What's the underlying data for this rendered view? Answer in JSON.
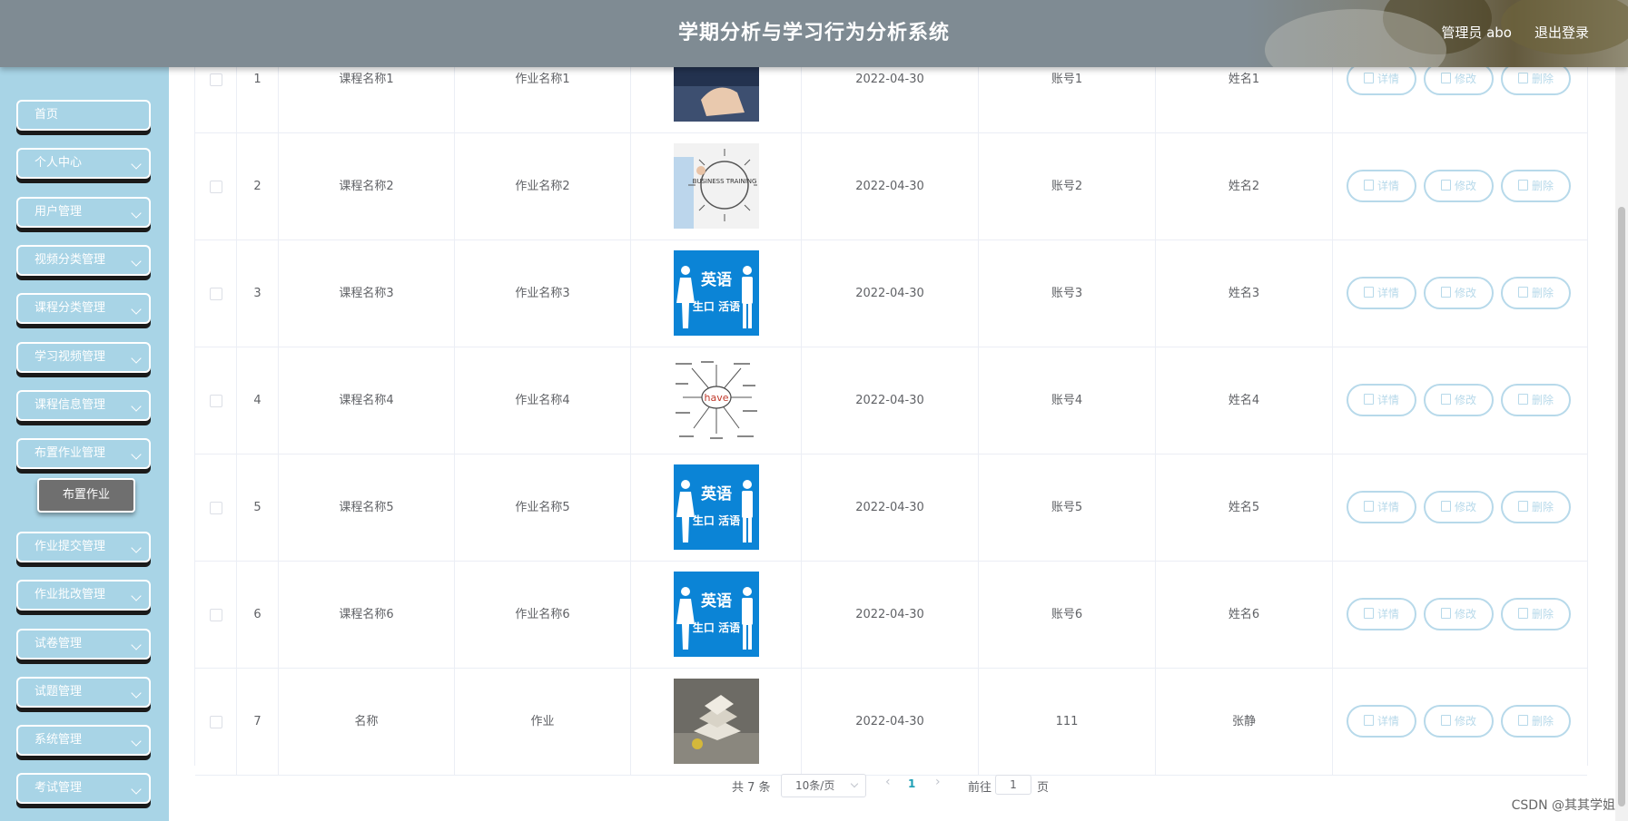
{
  "header": {
    "title": "学期分析与学习行为分析系统",
    "user": "管理员 abo",
    "logout": "退出登录"
  },
  "sidebar": {
    "items": [
      {
        "label": "首页",
        "expand": false
      },
      {
        "label": "个人中心",
        "expand": true
      },
      {
        "label": "用户管理",
        "expand": true
      },
      {
        "label": "视频分类管理",
        "expand": true
      },
      {
        "label": "课程分类管理",
        "expand": true
      },
      {
        "label": "学习视频管理",
        "expand": true
      },
      {
        "label": "课程信息管理",
        "expand": true
      },
      {
        "label": "布置作业管理",
        "expand": true
      },
      {
        "label": "作业提交管理",
        "expand": true
      },
      {
        "label": "作业批改管理",
        "expand": true
      },
      {
        "label": "试卷管理",
        "expand": true
      },
      {
        "label": "试题管理",
        "expand": true
      },
      {
        "label": "系统管理",
        "expand": true
      },
      {
        "label": "考试管理",
        "expand": true
      }
    ],
    "active_submenu": "布置作业"
  },
  "table": {
    "rows": [
      {
        "index": "1",
        "course": "课程名称1",
        "homework": "作业名称1",
        "date": "2022-04-30",
        "account": "账号1",
        "name": "姓名1",
        "image": "hand-writing"
      },
      {
        "index": "2",
        "course": "课程名称2",
        "homework": "作业名称2",
        "date": "2022-04-30",
        "account": "账号2",
        "name": "姓名2",
        "image": "business-training"
      },
      {
        "index": "3",
        "course": "课程名称3",
        "homework": "作业名称3",
        "date": "2022-04-30",
        "account": "账号3",
        "name": "姓名3",
        "image": "english-spoken"
      },
      {
        "index": "4",
        "course": "课程名称4",
        "homework": "作业名称4",
        "date": "2022-04-30",
        "account": "账号4",
        "name": "姓名4",
        "image": "word-have"
      },
      {
        "index": "5",
        "course": "课程名称5",
        "homework": "作业名称5",
        "date": "2022-04-30",
        "account": "账号5",
        "name": "姓名5",
        "image": "english-spoken"
      },
      {
        "index": "6",
        "course": "课程名称6",
        "homework": "作业名称6",
        "date": "2022-04-30",
        "account": "账号6",
        "name": "姓名6",
        "image": "english-spoken"
      },
      {
        "index": "7",
        "course": "名称",
        "homework": "作业",
        "date": "2022-04-30",
        "account": "111",
        "name": "张静",
        "image": "books"
      }
    ],
    "actions": {
      "detail": "详情",
      "edit": "修改",
      "delete": "删除"
    },
    "image_texts": {
      "english_top": "英语",
      "english_bottom": "生口 活语",
      "training": "BUSINESS TRAINING",
      "have": "have"
    }
  },
  "pagination": {
    "total": "共 7 条",
    "page_size": "10条/页",
    "current_page": "1",
    "goto_label": "前往",
    "goto_value": "1",
    "page_suffix": "页"
  },
  "watermark": "CSDN @其其学姐",
  "colors": {
    "header_bg": "#7f8b93",
    "sidebar_bg": "#a8d4e6",
    "action_border": "#b7d9ea",
    "page_active": "#1e9fb5"
  }
}
